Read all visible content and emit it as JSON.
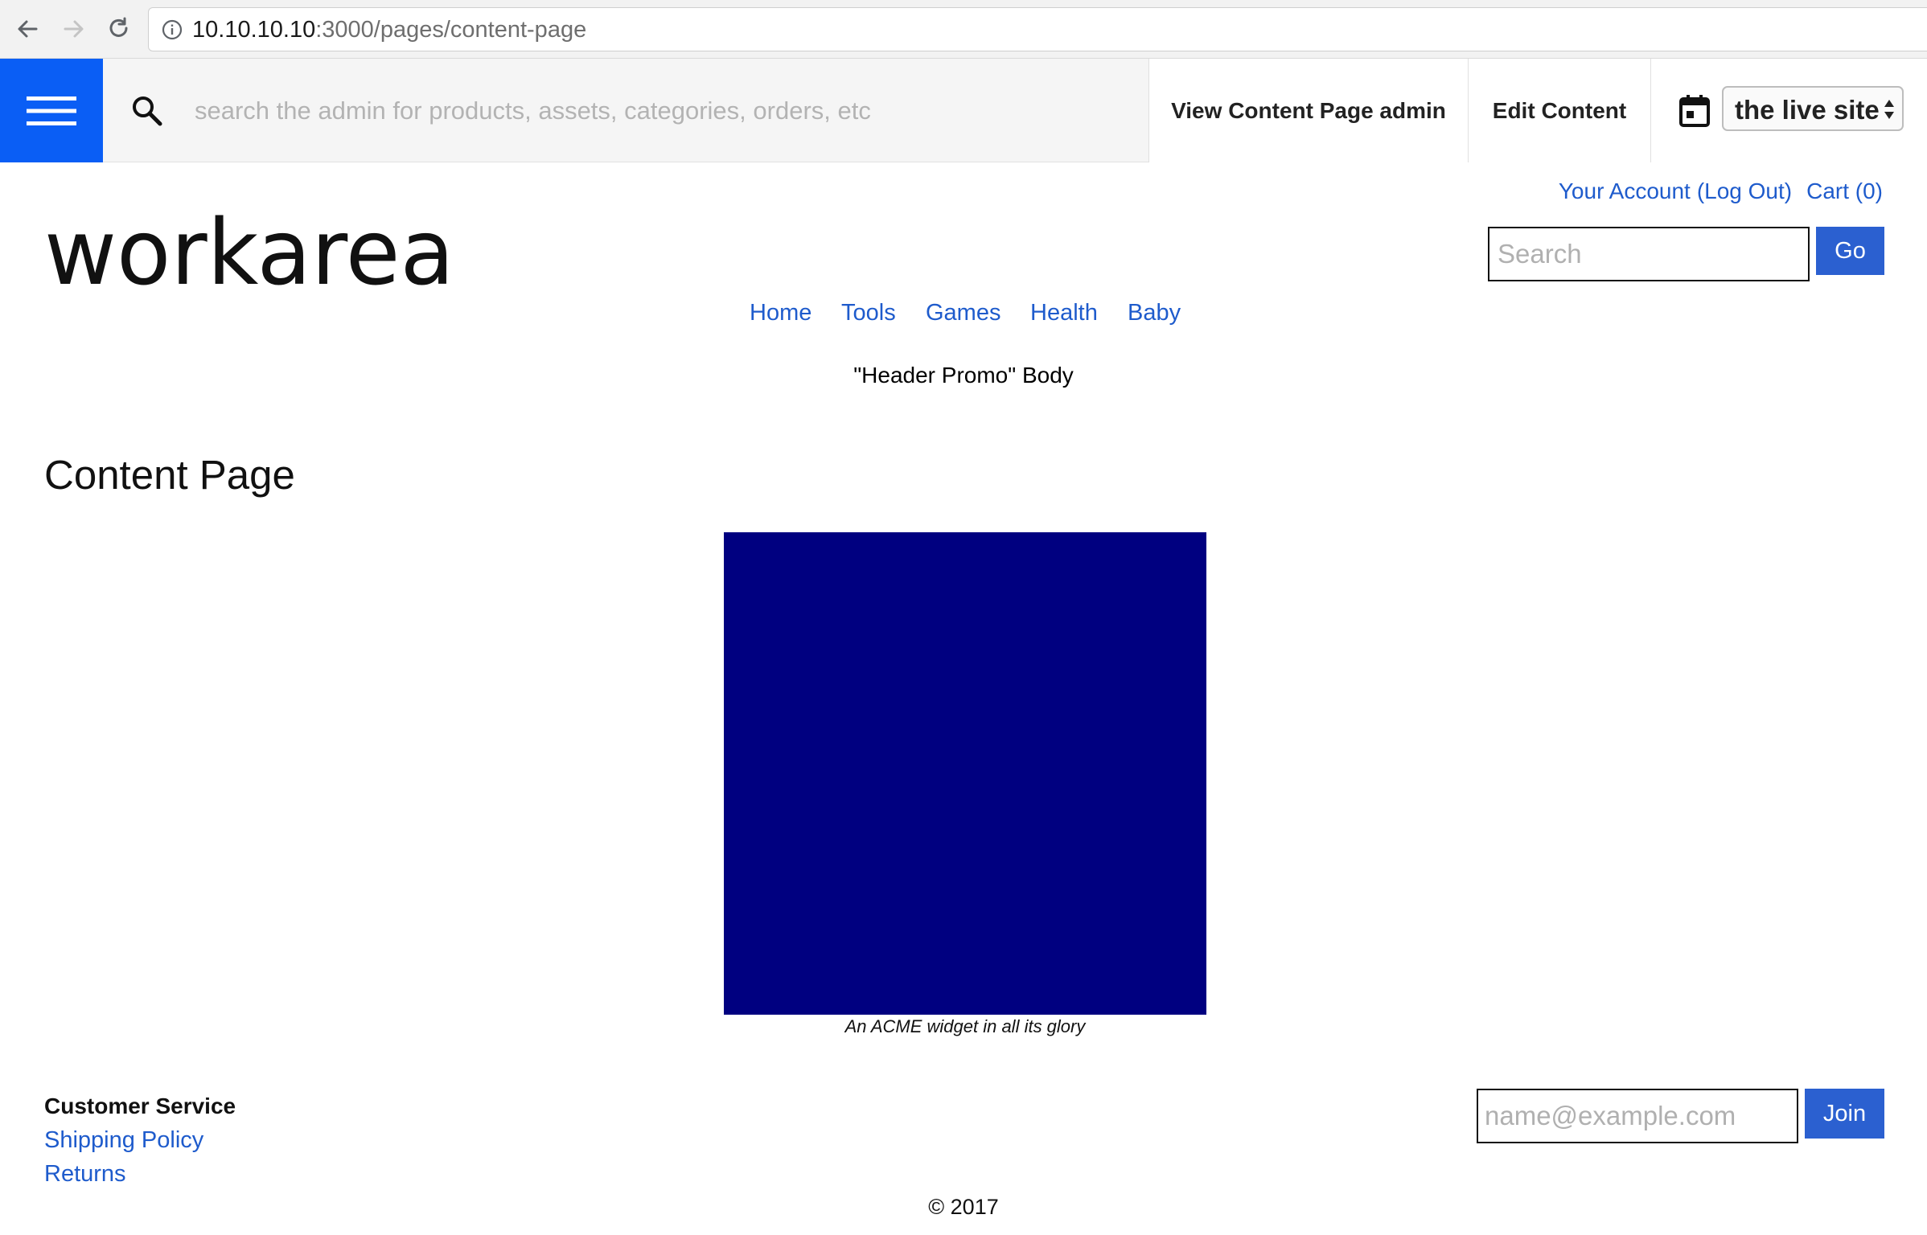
{
  "browser": {
    "url_host": "10.10.10.10",
    "url_path": ":3000/pages/content-page"
  },
  "admin_toolbar": {
    "search_placeholder": "search the admin for products, assets, categories, orders, etc",
    "view_admin_label": "View Content Page admin",
    "edit_content_label": "Edit Content",
    "release_selected": "the live site",
    "accent_color": "#0a5ef5"
  },
  "header": {
    "account_label": "Your Account",
    "logout_label": "(Log Out)",
    "cart_label": "Cart (0)",
    "logo_text": "workarea",
    "search_placeholder": "Search",
    "search_button": "Go",
    "nav": [
      "Home",
      "Tools",
      "Games",
      "Health",
      "Baby"
    ],
    "promo_text": "\"Header Promo\" Body",
    "link_color": "#1e5bcc"
  },
  "content": {
    "page_title": "Content Page",
    "image_color": "#000080",
    "image_caption": "An ACME widget in all its glory"
  },
  "footer": {
    "heading": "Customer Service",
    "links": [
      "Shipping Policy",
      "Returns"
    ],
    "email_placeholder": "name@example.com",
    "join_button": "Join",
    "copyright": "© 2017"
  }
}
